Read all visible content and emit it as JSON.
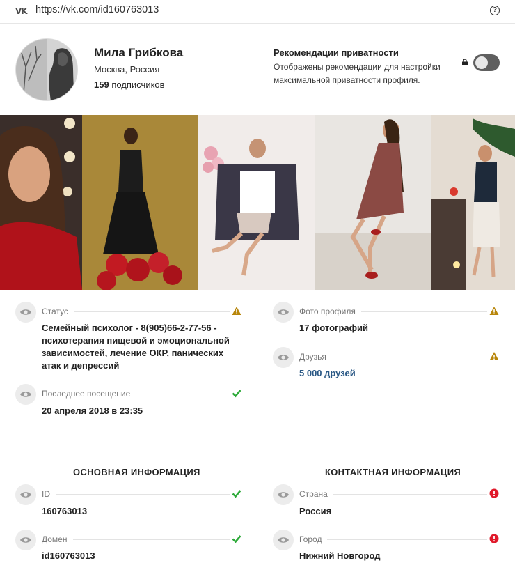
{
  "browser": {
    "logo": "VK",
    "url": "https://vk.com/id160763013",
    "help_icon": "question-circle-icon"
  },
  "profile": {
    "name": "Мила Грибкова",
    "location": "Москва, Россия",
    "subscribers_count": "159",
    "subscribers_label": "подписчиков"
  },
  "privacy": {
    "title": "Рекомендации приватности",
    "description": "Отображены рекомендации для настройки максимальной приватности профиля.",
    "toggle_on": false
  },
  "photos_count_shown": 5,
  "fields": {
    "status": {
      "label": "Статус",
      "value": "Семейный психолог - 8(905)66-2-77-56 - психотерапия пищевой и эмоциональной зависимостей, лечение ОКР, панических атак и депрессий",
      "mark": "warning"
    },
    "last_seen": {
      "label": "Последнее посещение",
      "value": "20 апреля 2018 в 23:35",
      "mark": "ok"
    },
    "profile_photo": {
      "label": "Фото профиля",
      "value": "17 фотографий",
      "mark": "warning"
    },
    "friends": {
      "label": "Друзья",
      "value": "5 000 друзей",
      "mark": "warning"
    },
    "id": {
      "label": "ID",
      "value": "160763013",
      "mark": "ok"
    },
    "domain": {
      "label": "Домен",
      "value": "id160763013",
      "mark": "ok"
    },
    "country": {
      "label": "Страна",
      "value": "Россия",
      "mark": "error"
    },
    "city": {
      "label": "Город",
      "value": "Нижний Новгород",
      "mark": "error"
    }
  },
  "sections": {
    "basic": "ОСНОВНАЯ ИНФОРМАЦИЯ",
    "contact": "КОНТАКТНАЯ ИНФОРМАЦИЯ"
  },
  "colors": {
    "warning": "#b8860b",
    "ok": "#2eaa3a",
    "error": "#e0192a",
    "link": "#2a5885",
    "toggle": "#5f5f5f"
  }
}
